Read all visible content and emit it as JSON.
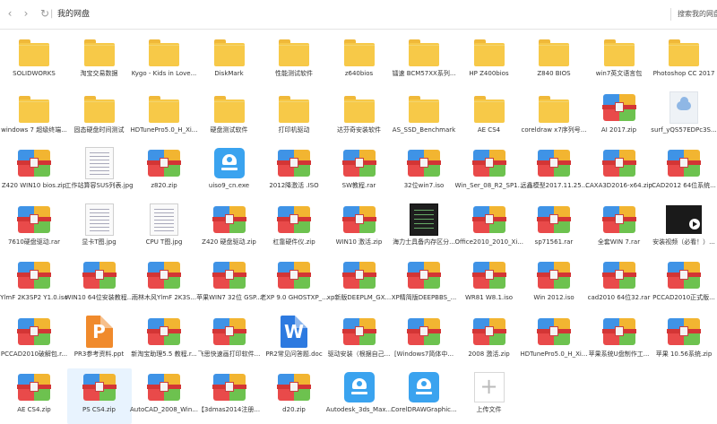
{
  "toolbar": {
    "back_icon": "chevron-left-icon",
    "forward_icon": "chevron-right-icon",
    "refresh_icon": "refresh-icon",
    "breadcrumb": "我的网盘",
    "search_label": "搜索我的网盘"
  },
  "files": [
    {
      "name": "SOLIDWORKS",
      "type": "folder"
    },
    {
      "name": "淘宝交易数据",
      "type": "folder"
    },
    {
      "name": "Kygo - Kids in Love...",
      "type": "folder"
    },
    {
      "name": "DiskMark",
      "type": "folder"
    },
    {
      "name": "性能测试软件",
      "type": "folder"
    },
    {
      "name": "z640bios",
      "type": "folder"
    },
    {
      "name": "镭速 BCM57XX系列...",
      "type": "folder"
    },
    {
      "name": "HP Z400bios",
      "type": "folder"
    },
    {
      "name": "Z840 BIOS",
      "type": "folder"
    },
    {
      "name": "win7英文语言包",
      "type": "folder"
    },
    {
      "name": "Photoshop CC 2017",
      "type": "folder"
    },
    {
      "name": "windows 7 超级终端...",
      "type": "folder"
    },
    {
      "name": "固态硬盘时间测试",
      "type": "folder"
    },
    {
      "name": "HDTunePro5.0_H_Xi...",
      "type": "folder"
    },
    {
      "name": "硬盘测试软件",
      "type": "folder"
    },
    {
      "name": "打印机驱动",
      "type": "folder"
    },
    {
      "name": "达芬奇安装软件",
      "type": "folder"
    },
    {
      "name": "AS_SSD_Benchmark",
      "type": "folder"
    },
    {
      "name": "AE CS4",
      "type": "folder"
    },
    {
      "name": "coreldraw x7序列号...",
      "type": "folder"
    },
    {
      "name": "AI 2017.zip",
      "type": "zip"
    },
    {
      "name": "surf_yQS57EDPc3S...",
      "type": "cloud"
    },
    {
      "name": "Z420 WIN10 bios.zip",
      "type": "zip"
    },
    {
      "name": "工作站算容SUS列表.jpg",
      "type": "img"
    },
    {
      "name": "z820.zip",
      "type": "zip"
    },
    {
      "name": "uiso9_cn.exe",
      "type": "exe"
    },
    {
      "name": "2012降激活 .ISO",
      "type": "zip"
    },
    {
      "name": "SW教程.rar",
      "type": "zip"
    },
    {
      "name": "32位win7.iso",
      "type": "zip"
    },
    {
      "name": "Win_Ser_08_R2_SP1...",
      "type": "zip"
    },
    {
      "name": "远鑫模型2017.11.25...",
      "type": "zip"
    },
    {
      "name": "CAXA3D2016-x64.zip",
      "type": "zip"
    },
    {
      "name": "CAD2012  64位系统...",
      "type": "zip"
    },
    {
      "name": "7610硬盘驱动.rar",
      "type": "zip"
    },
    {
      "name": "显卡T图.jpg",
      "type": "img"
    },
    {
      "name": "CPU T图.jpg",
      "type": "img"
    },
    {
      "name": "Z420 硬盘驱动.zip",
      "type": "zip"
    },
    {
      "name": "杠靠硬件仪.zip",
      "type": "zip"
    },
    {
      "name": "WIN10 激活.zip",
      "type": "zip"
    },
    {
      "name": "海力士具备内存区分...",
      "type": "imgdark"
    },
    {
      "name": "Office2010_2010_Xi...",
      "type": "zip"
    },
    {
      "name": "sp71561.rar",
      "type": "zip"
    },
    {
      "name": "全套WIN 7.rar",
      "type": "zip"
    },
    {
      "name": "安装视频（必看！）...",
      "type": "video"
    },
    {
      "name": "YlmF 2K3SP2 Y1.0.iso",
      "type": "zip"
    },
    {
      "name": "WIN10 64位安装教程...",
      "type": "zip"
    },
    {
      "name": "雨林木风YlmF 2K3S...",
      "type": "zip"
    },
    {
      "name": "苹果WIN7 32位 GSP...",
      "type": "zip"
    },
    {
      "name": "老XP 9.0 GHOSTXP_...",
      "type": "zip"
    },
    {
      "name": "xp新版DEEPLM_GX...",
      "type": "zip"
    },
    {
      "name": "XP精简版DEEPBBS_...",
      "type": "zip"
    },
    {
      "name": "WR81  W8.1.iso",
      "type": "zip"
    },
    {
      "name": "Win 2012.iso",
      "type": "zip"
    },
    {
      "name": "cad2010 64位32.rar",
      "type": "zip"
    },
    {
      "name": "PCCAD2010正式版...",
      "type": "zip"
    },
    {
      "name": "PCCAD2010破解包.r...",
      "type": "zip"
    },
    {
      "name": "PR3参考资料.ppt",
      "type": "ppt"
    },
    {
      "name": "新淘宝助理5.5 教程.r...",
      "type": "zip"
    },
    {
      "name": "飞思快速画打印软件...",
      "type": "zip"
    },
    {
      "name": "PR2常见问答题.doc",
      "type": "word"
    },
    {
      "name": "驱动安装（根据自己...",
      "type": "zip"
    },
    {
      "name": "[Windows7简体中...",
      "type": "zip"
    },
    {
      "name": "2008 激活.zip",
      "type": "zip"
    },
    {
      "name": "HDTunePro5.0_H_Xi...",
      "type": "zip"
    },
    {
      "name": "苹果系统U盘制作工...",
      "type": "zip"
    },
    {
      "name": "苹果 10.56系统.zip",
      "type": "zip"
    },
    {
      "name": "AE CS4.zip",
      "type": "zip"
    },
    {
      "name": "PS CS4.zip",
      "type": "zip",
      "selected": true
    },
    {
      "name": "AutoCAD_2008_Win...",
      "type": "zip"
    },
    {
      "name": "【3dmas2014注册...",
      "type": "zip"
    },
    {
      "name": "d20.zip",
      "type": "zip"
    },
    {
      "name": "Autodesk_3ds_Max...",
      "type": "exe"
    },
    {
      "name": "CorelDRAWGraphic...",
      "type": "exe"
    },
    {
      "name": "上传文件",
      "type": "upload"
    }
  ]
}
